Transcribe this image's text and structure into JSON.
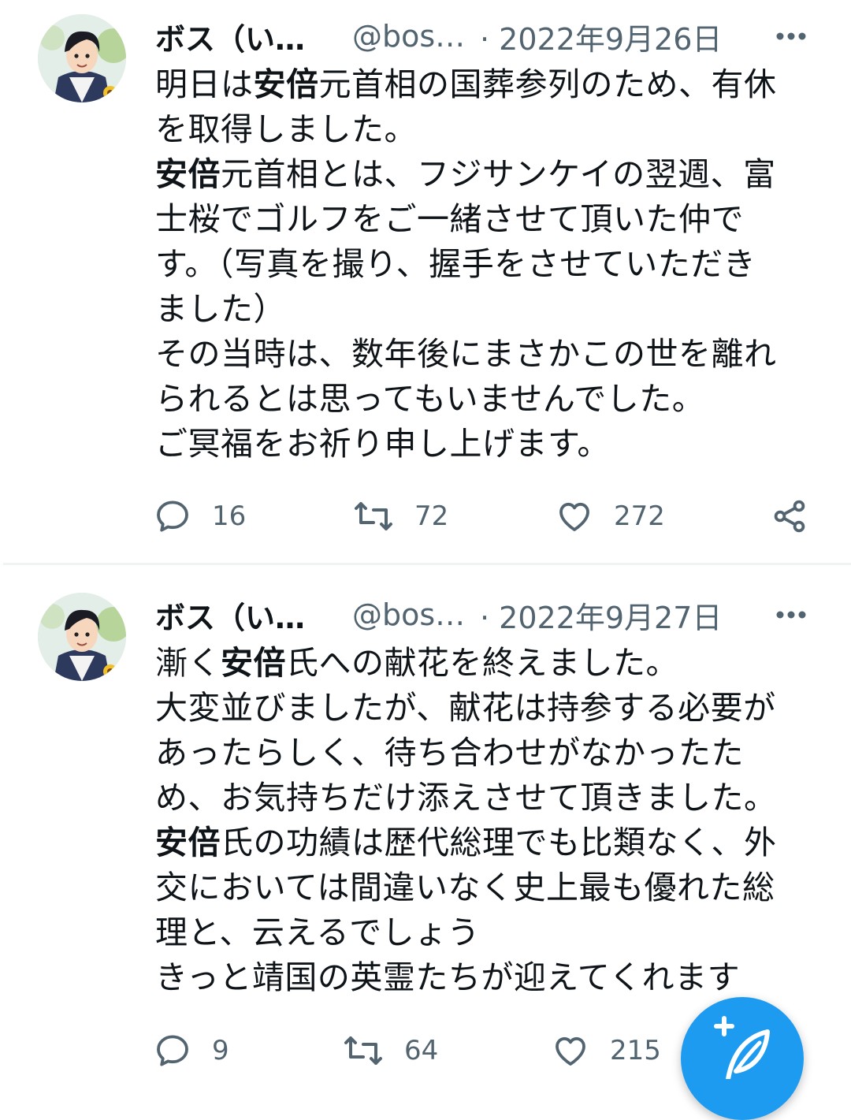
{
  "tweets": [
    {
      "name": "ボス（い…",
      "handle": "@bos…",
      "time": "· 2022年9月26日",
      "more_icon": "more-horizontal-icon",
      "lines": [
        [
          {
            "t": "明日は"
          },
          {
            "t": "安倍",
            "b": true
          },
          {
            "t": "元首相の国葬参列のため、有休"
          }
        ],
        [
          {
            "t": "を取得しました。"
          }
        ],
        [
          {
            "t": "安倍",
            "b": true
          },
          {
            "t": "元首相とは、フジサンケイの翌週、富"
          }
        ],
        [
          {
            "t": "士桜でゴルフをご一緒させて頂いた仲で"
          }
        ],
        [
          {
            "t": "す。（写真を撮り、握手をさせていただき"
          }
        ],
        [
          {
            "t": "ました）"
          }
        ],
        [
          {
            "t": "その当時は、数年後にまさかこの世を離れ"
          }
        ],
        [
          {
            "t": "られるとは思ってもいませんでした。"
          }
        ],
        [
          {
            "t": "ご冥福をお祈り申し上げます。"
          }
        ]
      ],
      "replies": "16",
      "retweets": "72",
      "likes": "272"
    },
    {
      "name": "ボス（い…",
      "handle": "@bos…",
      "time": "· 2022年9月27日",
      "more_icon": "more-horizontal-icon",
      "lines": [
        [
          {
            "t": "漸く"
          },
          {
            "t": "安倍",
            "b": true
          },
          {
            "t": "氏への献花を終えました。"
          }
        ],
        [
          {
            "t": "大変並びましたが、献花は持参する必要が"
          }
        ],
        [
          {
            "t": "あったらしく、待ち合わせがなかったた"
          }
        ],
        [
          {
            "t": "め、お気持ちだけ添えさせて頂きました。"
          }
        ],
        [
          {
            "t": "安倍",
            "b": true
          },
          {
            "t": "氏の功績は歴代総理でも比類なく、外"
          }
        ],
        [
          {
            "t": "交においては間違いなく史上最も優れた総"
          }
        ],
        [
          {
            "t": "理と、云えるでしょう"
          }
        ],
        [
          {
            "t": "きっと靖国の英霊たちが迎えてくれます"
          }
        ]
      ],
      "replies": "9",
      "retweets": "64",
      "likes": "215"
    }
  ],
  "fab": {
    "icon": "compose-tweet-icon"
  },
  "colors": {
    "accent": "#1d9bf0",
    "muted": "#536471",
    "text": "#0f1419",
    "divider": "#eff3f4"
  }
}
